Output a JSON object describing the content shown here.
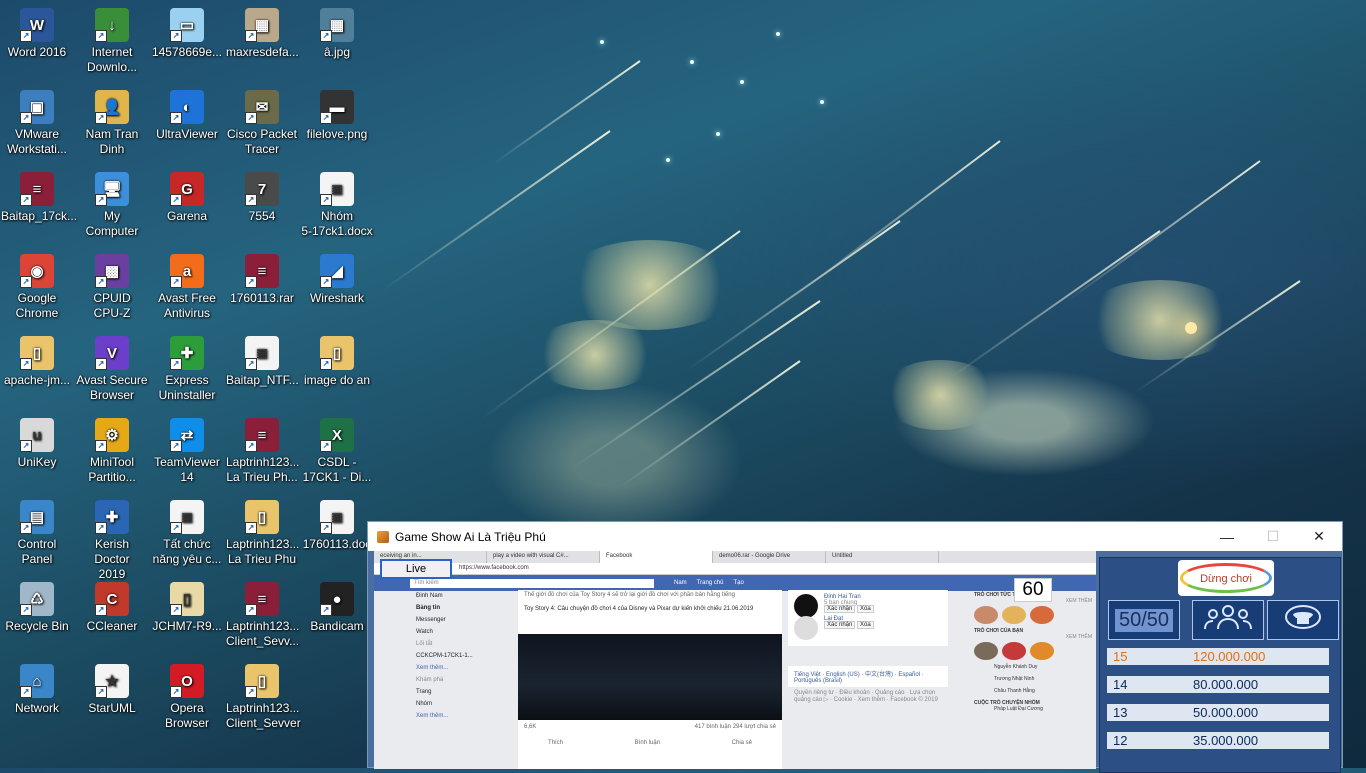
{
  "desktop": {
    "icons": [
      {
        "label": "Word 2016",
        "color": "#2b579a",
        "glyph": "W",
        "icon": "word-icon"
      },
      {
        "label": "Internet\nDownlo...",
        "color": "#3a8e3a",
        "glyph": "↓",
        "icon": "idm-icon"
      },
      {
        "label": "14578669e...",
        "color": "#9bd1f0",
        "glyph": "▭",
        "icon": "image-file-icon"
      },
      {
        "label": "maxresdefa...",
        "color": "#b9a98a",
        "glyph": "▦",
        "icon": "image-file-icon"
      },
      {
        "label": "â.jpg",
        "color": "#4f7f99",
        "glyph": "▦",
        "icon": "image-file-icon"
      },
      {
        "label": "VMware\nWorkstati...",
        "color": "#3d7ebf",
        "glyph": "▣",
        "icon": "vmware-icon"
      },
      {
        "label": "Nam Tran\nDinh",
        "color": "#e0b64c",
        "glyph": "👤",
        "icon": "user-folder-icon"
      },
      {
        "label": "UltraViewer",
        "color": "#1e73d8",
        "glyph": "◐",
        "icon": "ultraviewer-icon"
      },
      {
        "label": "Cisco Packet\nTracer",
        "color": "#6b6b4a",
        "glyph": "✉",
        "icon": "cisco-icon"
      },
      {
        "label": "filelove.png",
        "color": "#333",
        "glyph": "▬",
        "icon": "image-file-icon"
      },
      {
        "label": "Baitap_17ck...",
        "color": "#8b1f3a",
        "glyph": "≡",
        "icon": "winrar-icon"
      },
      {
        "label": "My\nComputer",
        "color": "#3c8fd8",
        "glyph": "🖥",
        "icon": "computer-icon"
      },
      {
        "label": "Garena",
        "color": "#c62828",
        "glyph": "G",
        "icon": "garena-icon"
      },
      {
        "label": "7554",
        "color": "#4a4a4a",
        "glyph": "7",
        "icon": "game-icon"
      },
      {
        "label": "Nhóm\n5-17ck1.docx",
        "color": "#f4f4f4",
        "glyph": "≣",
        "icon": "document-icon"
      },
      {
        "label": "Google\nChrome",
        "color": "#db4437",
        "glyph": "◉",
        "icon": "chrome-icon"
      },
      {
        "label": "CPUID\nCPU-Z",
        "color": "#6a3fa0",
        "glyph": "▩",
        "icon": "cpuz-icon"
      },
      {
        "label": "Avast Free\nAntivirus",
        "color": "#f26c1c",
        "glyph": "a",
        "icon": "avast-icon"
      },
      {
        "label": "1760113.rar",
        "color": "#8b1f3a",
        "glyph": "≡",
        "icon": "winrar-icon"
      },
      {
        "label": "Wireshark",
        "color": "#2a7bd0",
        "glyph": "◢",
        "icon": "wireshark-icon"
      },
      {
        "label": "apache-jm...",
        "color": "#e9c46a",
        "glyph": "▯",
        "icon": "folder-icon"
      },
      {
        "label": "Avast Secure\nBrowser",
        "color": "#6b3fc9",
        "glyph": "V",
        "icon": "avast-browser-icon"
      },
      {
        "label": "Express\nUninstaller",
        "color": "#2d9c3a",
        "glyph": "✚",
        "icon": "uninstaller-icon"
      },
      {
        "label": "Baitap_NTF...",
        "color": "#f4f4f4",
        "glyph": "≣",
        "icon": "document-icon"
      },
      {
        "label": "image do an",
        "color": "#e9c46a",
        "glyph": "▯",
        "icon": "folder-icon"
      },
      {
        "label": "UniKey",
        "color": "#d9d9d9",
        "glyph": "u",
        "icon": "unikey-icon"
      },
      {
        "label": "MiniTool\nPartitio...",
        "color": "#e6a817",
        "glyph": "⚙",
        "icon": "minitool-icon"
      },
      {
        "label": "TeamViewer\n14",
        "color": "#0e8ee9",
        "glyph": "⇄",
        "icon": "teamviewer-icon"
      },
      {
        "label": "Laptrinh123...\nLa Trieu Ph...",
        "color": "#8b1f3a",
        "glyph": "≡",
        "icon": "winrar-icon"
      },
      {
        "label": "CSDL -\n17CK1 - Di...",
        "color": "#1e7145",
        "glyph": "X",
        "icon": "excel-icon"
      },
      {
        "label": "Control\nPanel",
        "color": "#3a86c8",
        "glyph": "▤",
        "icon": "control-panel-icon"
      },
      {
        "label": "Kerish Doctor\n2019",
        "color": "#2a66b3",
        "glyph": "✚",
        "icon": "kerish-icon"
      },
      {
        "label": "Tất chức\nnăng yêu c...",
        "color": "#f4f4f4",
        "glyph": "≣",
        "icon": "document-icon"
      },
      {
        "label": "Laptrinh123...\nLa Trieu Phu",
        "color": "#e9c46a",
        "glyph": "▯",
        "icon": "folder-zip-icon"
      },
      {
        "label": "1760113.doc",
        "color": "#f4f4f4",
        "glyph": "≣",
        "icon": "document-icon"
      },
      {
        "label": "Recycle Bin",
        "color": "#9fb7c9",
        "glyph": "♺",
        "icon": "recycle-bin-icon"
      },
      {
        "label": "CCleaner",
        "color": "#c0392b",
        "glyph": "C",
        "icon": "ccleaner-icon"
      },
      {
        "label": "JCHM7-R9...",
        "color": "#e9d9a6",
        "glyph": "▯",
        "icon": "folder-icon"
      },
      {
        "label": "Laptrinh123...\nClient_Sevv...",
        "color": "#8b1f3a",
        "glyph": "≡",
        "icon": "winrar-icon"
      },
      {
        "label": "Bandicam",
        "color": "#222",
        "glyph": "●",
        "icon": "bandicam-icon"
      },
      {
        "label": "Network",
        "color": "#3a86c8",
        "glyph": "⌂",
        "icon": "network-icon"
      },
      {
        "label": "StarUML",
        "color": "#f4f4f4",
        "glyph": "★",
        "icon": "staruml-icon"
      },
      {
        "label": "Opera\nBrowser",
        "color": "#d21b24",
        "glyph": "O",
        "icon": "opera-icon"
      },
      {
        "label": "Laptrinh123...\nClient_Sevver",
        "color": "#e9c46a",
        "glyph": "▯",
        "icon": "folder-icon"
      }
    ]
  },
  "window": {
    "title": "Game Show Ai Là Triệu Phú",
    "minimize": "—",
    "maximize": "☐",
    "close": "✕"
  },
  "game": {
    "live_label": "Live",
    "timer": "60",
    "stop_label": "Dừng chơi",
    "fifty_label": "50/50",
    "prizes": [
      {
        "level": "15",
        "amount": "120.000.000"
      },
      {
        "level": "14",
        "amount": "80.000.000"
      },
      {
        "level": "13",
        "amount": "50.000.000"
      },
      {
        "level": "12",
        "amount": "35.000.000"
      }
    ]
  },
  "browser": {
    "tabs": [
      "eceiving an in...",
      "play a video with visual C#...",
      "Facebook",
      "demo06.rar - Google Drive",
      "Untitled"
    ],
    "url": "https://www.facebook.com",
    "search_placeholder": "Tìm kiếm",
    "user": "Nam",
    "nav": [
      "Trang chủ",
      "Tạo"
    ],
    "left_nav": [
      "Đinh Nam",
      "Bảng tin",
      "Messenger",
      "Watch",
      "Lối tắt",
      "CCKCPM-17CK1-1...",
      "Xem thêm...",
      "Khám phá",
      "Trang",
      "Nhóm",
      "Xem thêm..."
    ],
    "post_text": "Toy Story 4: Câu chuyện đồ chơi 4 của Disney và Pixar dự kiến khởi chiếu 21.06.2019",
    "post_top": "Thế giới đồ chơi của Toy Story 4 sẽ trở lại giới đồ chơi với phần bản hằng tiếng",
    "reactions": "6,6K",
    "comments": "417 bình luận  294 lượt chia sẻ",
    "actions": [
      "Thích",
      "Bình luận",
      "Chia sẻ"
    ],
    "friend1": {
      "name": "Đinh Hai Tran",
      "sub": "5 bạn chung",
      "confirm": "Xác nhận",
      "delete": "Xóa"
    },
    "friend2": {
      "name": "Lại Đạt",
      "confirm": "Xác nhận",
      "delete": "Xóa"
    },
    "footer_lang": "Tiếng Việt · English (US) · 中文(台灣) · Español · Português (Brasil)",
    "footer_links": "Quyền riêng tư · Điều khoản · Quảng cáo · Lựa chọn quảng cáo ▷ · Cookie · Xem thêm · Facebook © 2019",
    "games_header": "TRÒ CHƠI TỨC THÌ",
    "games_header2": "TRÒ CHƠI CỦA BẠN",
    "more": "XEM THÊM",
    "contacts": [
      "Nguyễn Khánh Duy",
      "Trương Nhật Ninh",
      "Châu Thanh Hằng"
    ],
    "convo_header": "CUỘC TRÒ CHUYỆN NHÓM",
    "convo": "Pháp Luật Đại Cương"
  }
}
